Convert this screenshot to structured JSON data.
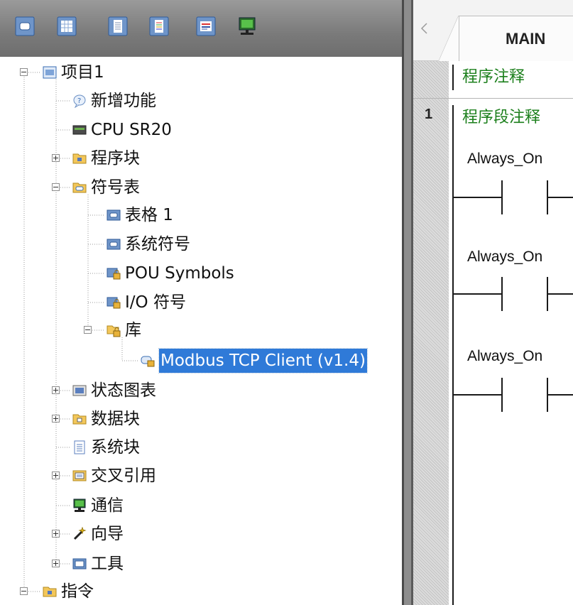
{
  "toolbar": {
    "buttons": [
      {
        "icon": "block-view-icon"
      },
      {
        "icon": "table-view-icon"
      },
      {
        "icon": "list-view-icon"
      },
      {
        "icon": "colored-list-icon"
      },
      {
        "icon": "properties-icon"
      },
      {
        "icon": "communications-icon"
      }
    ]
  },
  "tree": {
    "project_root": "项目1",
    "new_features": "新增功能",
    "cpu": "CPU SR20",
    "program_block": "程序块",
    "symbol_table": "符号表",
    "table_1": "表格 1",
    "system_symbols": "系统符号",
    "pou_symbols": "POU Symbols",
    "io_symbols": "I/O 符号",
    "library": "库",
    "modbus_tcp_client": "Modbus TCP Client (v1.4)",
    "status_chart": "状态图表",
    "data_block": "数据块",
    "system_block": "系统块",
    "cross_reference": "交叉引用",
    "communication": "通信",
    "wizards": "向导",
    "tools": "工具",
    "instructions": "指令"
  },
  "editor": {
    "tab_label": "MAIN",
    "program_comment": "程序注释",
    "network_number": "1",
    "network_comment": "程序段注释",
    "contacts": [
      "Always_On",
      "Always_On",
      "Always_On"
    ]
  },
  "colors": {
    "selection": "#2f7ad8",
    "comment_text": "#1b7f1b",
    "toolbar_bg": "#8a8a8a"
  }
}
